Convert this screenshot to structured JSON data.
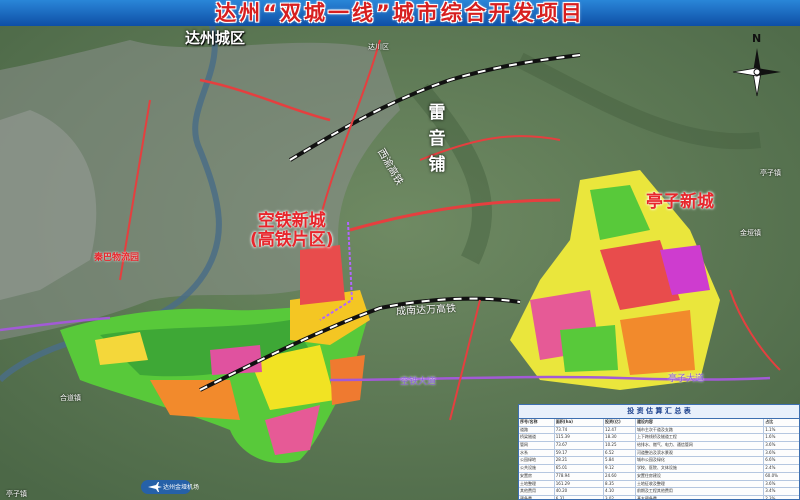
{
  "title": "达州“双城一线”城市综合开发项目",
  "labels": {
    "dazhou_district": "达州城区",
    "dachuan": "达川区",
    "kongtie_line1": "空铁新城",
    "kongtie_line2": "(高铁片区)",
    "tingzi": "亭子新城",
    "leiyinpu_chars": [
      "雷",
      "音",
      "铺"
    ],
    "qinba_logistics": "秦巴物流园",
    "hechuan_town": "合道镇",
    "tingzi_town": "亭子镇",
    "jinya_town": "金垭镇",
    "tingzi_bottom": "亭子镇",
    "chengnan_rail": "成南达万高铁",
    "xiyu_rail": "西渝高铁",
    "kongtie_road": "空铁大道",
    "tingzi_road": "亭子大道"
  },
  "compass": {
    "north_label": "N"
  },
  "airport_label": "达州金垭机场",
  "table": {
    "title": "投 资 估 算 汇 总 表",
    "rows": [
      [
        "序号/名称",
        "面积(ha)",
        "投资(亿)",
        "建设内容",
        "占比"
      ],
      [
        "道路",
        "73.74",
        "12.47",
        "城市主次干道及支路",
        "1.1%"
      ],
      [
        "桥梁隧道",
        "115.39",
        "18.30",
        "上下跨线桥及隧道工程",
        "1.6%"
      ],
      [
        "管网",
        "73.67",
        "10.25",
        "给排水、燃气、电力、通信管网",
        "3.6%"
      ],
      [
        "水系",
        "59.17",
        "6.52",
        "河道整治及滨水景观",
        "3.6%"
      ],
      [
        "公园绿地",
        "28.21",
        "5.84",
        "城市公园及绿化",
        "6.6%"
      ],
      [
        "公共设施",
        "65.01",
        "9.12",
        "学校、医院、文体设施",
        "2.4%"
      ],
      [
        "安置房",
        "778.94",
        "24.60",
        "安置住房建设",
        "60.0%"
      ],
      [
        "土地整理",
        "161.29",
        "8.35",
        "土地征收及整理",
        "3.6%"
      ],
      [
        "其他费用",
        "40.20",
        "4.10",
        "前期及工程其他费用",
        "3.4%"
      ],
      [
        "预备费",
        "6.31",
        "3.02",
        "基本预备费",
        "2.3%"
      ],
      [
        "建设期利息",
        "21.26",
        "5.56",
        "融资利息",
        "4.5%"
      ],
      [
        "总投资",
        "986.86",
        "118.2",
        "合计",
        "100%"
      ]
    ]
  }
}
